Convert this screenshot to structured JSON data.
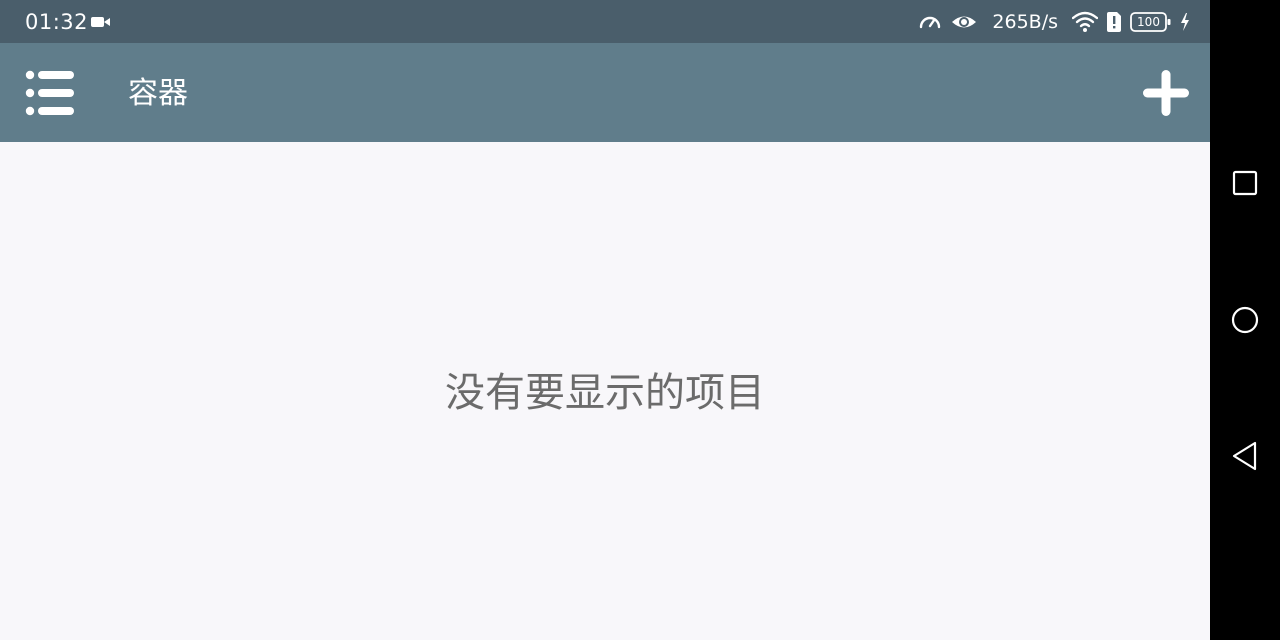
{
  "status_bar": {
    "time": "01:32",
    "network_speed": "265B/s",
    "battery": "100",
    "icons": [
      "video-record-icon",
      "speedometer-icon",
      "eye-icon",
      "wifi-icon",
      "sim-alert-icon",
      "battery-icon",
      "charging-icon"
    ]
  },
  "toolbar": {
    "title": "容器",
    "menu_icon": "list-menu-icon",
    "add_icon": "plus-icon"
  },
  "main": {
    "empty_message": "没有要显示的项目"
  },
  "nav_bar": {
    "icons": [
      "recents-square-icon",
      "home-circle-icon",
      "back-triangle-icon"
    ]
  },
  "colors": {
    "status_bar": "#4a5e6b",
    "toolbar": "#607d8b",
    "content_background": "#f8f7fa",
    "empty_text": "#6b6b6b",
    "nav_bar": "#000000"
  }
}
